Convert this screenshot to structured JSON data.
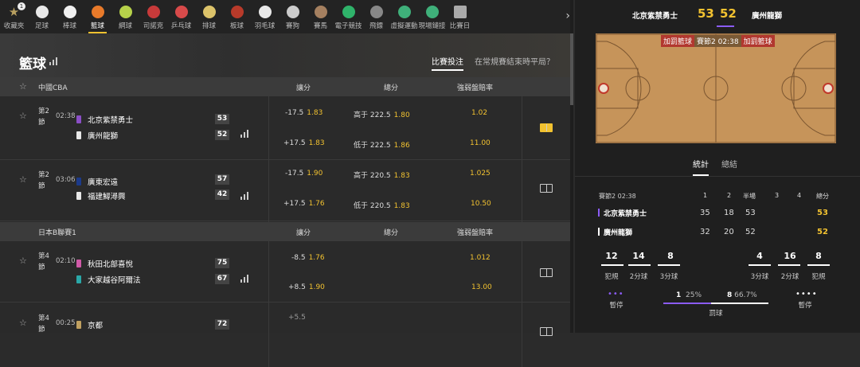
{
  "sports": [
    {
      "label": "收藏夾",
      "icon": "star-icon",
      "color": "#b8a060",
      "badge": "1"
    },
    {
      "label": "足球",
      "icon": "soccer-ball-icon",
      "color": "#e8e8e8"
    },
    {
      "label": "棒球",
      "icon": "baseball-icon",
      "color": "#f0f0f0"
    },
    {
      "label": "籃球",
      "icon": "basketball-icon",
      "color": "#e87a2a"
    },
    {
      "label": "網球",
      "icon": "tennis-ball-icon",
      "color": "#b6d14a"
    },
    {
      "label": "司諾克",
      "icon": "snooker-icon",
      "color": "#c83a3a"
    },
    {
      "label": "乒乓球",
      "icon": "table-tennis-icon",
      "color": "#d84a4a"
    },
    {
      "label": "排球",
      "icon": "volleyball-icon",
      "color": "#dcc36a"
    },
    {
      "label": "板球",
      "icon": "cricket-ball-icon",
      "color": "#b83a2a"
    },
    {
      "label": "羽毛球",
      "icon": "shuttlecock-icon",
      "color": "#e8e8e8"
    },
    {
      "label": "賽狗",
      "icon": "dog-icon",
      "color": "#ccc"
    },
    {
      "label": "賽馬",
      "icon": "horse-icon",
      "color": "#a58060"
    },
    {
      "label": "電子競技",
      "icon": "gamepad-icon",
      "color": "#2fb36a"
    },
    {
      "label": "飛鏢",
      "icon": "dartboard-icon",
      "color": "#888"
    },
    {
      "label": "虛擬運動",
      "icon": "virtual-sports-icon",
      "color": "#3fb07a"
    },
    {
      "label": "現場鏈接",
      "icon": "live-link-icon",
      "color": "#3fb07a"
    },
    {
      "label": "比賽日",
      "icon": "calendar-icon",
      "color": "#aaa"
    }
  ],
  "page_title": "籃球",
  "tabs": {
    "active": "比賽投注",
    "other": "在常規賽結束時平局？"
  },
  "columns": {
    "handicap": "讓分",
    "total": "總分",
    "moneyline": "強弱盤賠率"
  },
  "leagues": [
    {
      "name": "中國CBA"
    },
    {
      "name": "日本B聯賽1"
    }
  ],
  "matches": [
    {
      "period": "第2節",
      "clock": "02:38",
      "home": "北京紫禁勇士",
      "away": "廣州龍獅",
      "home_score": "53",
      "away_score": "52",
      "home_hc": "-17.5",
      "home_hc_p": "1.83",
      "away_hc": "+17.5",
      "away_hc_p": "1.83",
      "over": "高于 222.5",
      "over_p": "1.80",
      "under": "低于 222.5",
      "under_p": "1.86",
      "ml_home": "1.02",
      "ml_away": "11.00",
      "home_color": "#8b4fc6",
      "away_color": "#e8e8e8"
    },
    {
      "period": "第2節",
      "clock": "03:06",
      "home": "廣東宏遠",
      "away": "福建鱘潯興",
      "home_score": "57",
      "away_score": "42",
      "home_hc": "-17.5",
      "home_hc_p": "1.90",
      "away_hc": "+17.5",
      "away_hc_p": "1.76",
      "over": "高于 220.5",
      "over_p": "1.83",
      "under": "低于 220.5",
      "under_p": "1.83",
      "ml_home": "1.025",
      "ml_away": "10.50",
      "home_color": "#1c3a8a",
      "away_color": "#e8e8e8"
    },
    {
      "period": "第4節",
      "clock": "02:10",
      "home": "秋田北部喜悅",
      "away": "大家越谷阿爾法",
      "home_score": "75",
      "away_score": "67",
      "home_hc": "-8.5",
      "home_hc_p": "1.76",
      "away_hc": "+8.5",
      "away_hc_p": "1.90",
      "ml_home": "1.012",
      "ml_away": "13.00",
      "home_color": "#d05aa8",
      "away_color": "#2aa8a8"
    },
    {
      "period": "第4節",
      "clock": "00:25",
      "home": "京都",
      "home_score": "72",
      "home_hc": "+5.5",
      "home_color": "#c0a060"
    }
  ],
  "game": {
    "home": "北京紫禁勇士",
    "away": "廣州龍獅",
    "home_score": "53",
    "away_score": "52",
    "tag_home": "加罰籃球",
    "tag_mid": "賽節2",
    "tag_clock": "02:38",
    "tag_away": "加罰籃球"
  },
  "detail_tabs": {
    "stats": "統計",
    "summary": "總結"
  },
  "score_table": {
    "period_label": "賽節2",
    "clock": "02:38",
    "cols": [
      "1",
      "2",
      "半場",
      "3",
      "4",
      "總分"
    ],
    "rows": [
      {
        "team": "北京紫禁勇士",
        "vals": [
          "35",
          "18",
          "53",
          "",
          "",
          "53"
        ]
      },
      {
        "team": "廣州龍獅",
        "vals": [
          "32",
          "20",
          "52",
          "",
          "",
          "52"
        ]
      }
    ]
  },
  "stats": {
    "home": [
      {
        "v": "12",
        "l": "犯規"
      },
      {
        "v": "14",
        "l": "2分球"
      },
      {
        "v": "8",
        "l": "3分球"
      }
    ],
    "away": [
      {
        "v": "4",
        "l": "3分球"
      },
      {
        "v": "16",
        "l": "2分球"
      },
      {
        "v": "8",
        "l": "犯規"
      }
    ],
    "timeouts_label": "暫停",
    "ft_label": "罰球",
    "ft_home": "1",
    "ft_home_pct": "25%",
    "ft_away": "8",
    "ft_away_pct": "66.7%"
  }
}
